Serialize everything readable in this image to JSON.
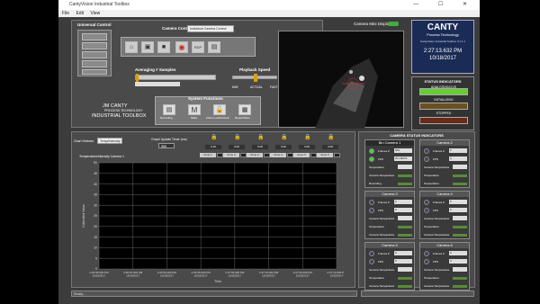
{
  "window": {
    "title": "CantyVision Industrial Toolbox",
    "controls": "— ☐ ✕"
  },
  "menu": [
    "File",
    "Edit",
    "View"
  ],
  "universal": {
    "title": "Universal Control"
  },
  "camera_control": {
    "label": "Camera Control",
    "value": "Individual Camera Control"
  },
  "averaging": {
    "label": "Averaging # Samples",
    "min": "1",
    "max": "100"
  },
  "playback": {
    "label": "Playback Speed",
    "min": "MIN",
    "actual": "ACTUAL",
    "fast": "FAST"
  },
  "camera_mini": {
    "label": "Camera Mini Display"
  },
  "logo": {
    "brand": "CANTY",
    "sub": "Process Technology",
    "version": "CantyVision Industrial Toolbox V.1.1.1",
    "time": "2:27:13.632 PM",
    "date": "10/18/2017"
  },
  "status": {
    "title": "STATUS INDICATORS",
    "items": [
      "ANALYZING/LIVE",
      "INITIALIZING",
      "STOPPED"
    ]
  },
  "brand_block": {
    "line1": "JM CANTY",
    "line2": "PROCESS TECHNOLOGY",
    "line3": "INDUSTRIAL TOOLBOX"
  },
  "sysfn": {
    "title": "System Functions",
    "buttons": [
      "Recording",
      "Mask",
      "Admin Lock/Unlock",
      "Report/Save"
    ]
  },
  "chart_ctrl": {
    "select_label": "Chart Selector",
    "select_value": "Temp/Intensity",
    "update_label": "Graph Update Timer (ms)",
    "update_value": "550"
  },
  "zones": {
    "values": [
      "0.10",
      "0.00",
      "0.00",
      "0.00",
      "0.00",
      "0.00"
    ],
    "labels": [
      "Zone 1",
      "Zone 2",
      "Zone 3",
      "Zone 4",
      "Zone 5",
      "Zone 6"
    ]
  },
  "chart_data": {
    "type": "line",
    "title": "Temperature/Intensity Camera 1",
    "ylabel": "Calibrated Value",
    "xlabel": "Time",
    "x": [
      "2:26:58.000 PM 10/18/2017",
      "2:26:15.000 PM 10/18/2017",
      "2:26:30.000 PM 10/18/2017",
      "2:26:45.000 PM 10/18/2017",
      "2:27:00.000 PM 10/18/2017",
      "2:27:15.000 PM 10/18/2017",
      "2:27:30.000 PM 10/18/2017",
      "2:27:13.000 PM 10/18/2017"
    ],
    "ylim": [
      0,
      50
    ],
    "yticks": [
      "50",
      "45",
      "40",
      "35",
      "30",
      "25",
      "20",
      "15",
      "10",
      "5",
      "0"
    ],
    "series": [],
    "grid": true
  },
  "cam_status": {
    "title": "CAMERA STATUS INDICATORS",
    "cameras": [
      {
        "name": "Bin Camera 1",
        "f1": "Frames #",
        "v1": "684",
        "f2": "FPS",
        "v2": "30.10FPS",
        "f3": "Temperature",
        "f4": "Camera Temperature",
        "f5": "Recording",
        "active": true
      },
      {
        "name": "Camera 2",
        "f1": "Frames #",
        "v1": "0",
        "f2": "FPS",
        "v2": "0",
        "f3": "Camera Temperature",
        "f4": "Temperature",
        "f5": "Temperature",
        "active": false
      },
      {
        "name": "Camera 3",
        "f1": "Frames #",
        "v1": "0",
        "f2": "FPS",
        "v2": "0",
        "f3": "Camera Temperature",
        "f4": "Temperature",
        "f5": "Camera Temperature",
        "active": false
      },
      {
        "name": "Camera 4",
        "f1": "Frames #",
        "v1": "0",
        "f2": "FPS",
        "v2": "0",
        "f3": "Camera Temperature",
        "f4": "Temperature",
        "f5": "Camera Temperature",
        "active": false
      },
      {
        "name": "Camera 5",
        "f1": "Frames #",
        "v1": "0",
        "f2": "FPS",
        "v2": "0",
        "f3": "Camera Temperature",
        "f4": "Temperature",
        "f5": "Camera Temperature",
        "active": false
      },
      {
        "name": "Camera 6",
        "f1": "Frames #",
        "v1": "0",
        "f2": "FPS",
        "v2": "0",
        "f3": "Camera Temperature",
        "f4": "Temperature",
        "f5": "Camera Temperature",
        "active": false
      }
    ]
  },
  "statusbar": {
    "text": "Ready..."
  }
}
